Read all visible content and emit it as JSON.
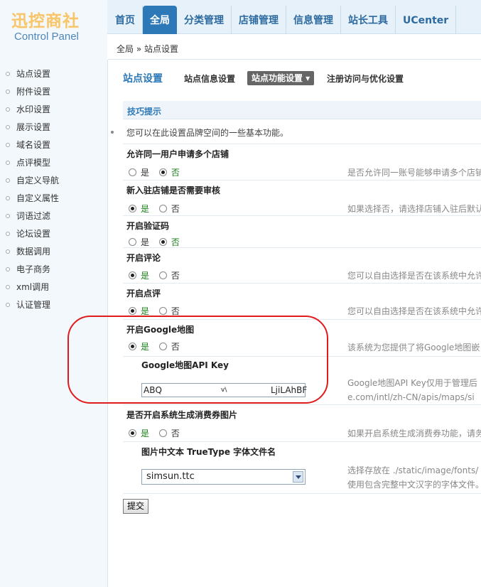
{
  "brand": {
    "name": "迅控商社",
    "subtitle": "Control Panel"
  },
  "nav": {
    "items": [
      {
        "label": "首页",
        "active": false
      },
      {
        "label": "全局",
        "active": true
      },
      {
        "label": "分类管理",
        "active": false
      },
      {
        "label": "店铺管理",
        "active": false
      },
      {
        "label": "信息管理",
        "active": false
      },
      {
        "label": "站长工具",
        "active": false
      },
      {
        "label": "UCenter",
        "active": false
      }
    ]
  },
  "breadcrumb": "全局 » 站点设置",
  "sidebar": {
    "items": [
      "站点设置",
      "附件设置",
      "水印设置",
      "展示设置",
      "域名设置",
      "点评模型",
      "自定义导航",
      "自定义属性",
      "词语过滤",
      "论坛设置",
      "数据调用",
      "电子商务",
      "xml调用",
      "认证管理"
    ]
  },
  "tabs": {
    "title": "站点设置",
    "items": [
      "站点信息设置",
      "站点功能设置 ▾",
      "注册访问与优化设置"
    ]
  },
  "tips": {
    "heading": "技巧提示",
    "line": "您可以在此设置品牌空间的一些基本功能。"
  },
  "radio_yes": "是",
  "radio_no": "否",
  "settings": {
    "multi_shop": {
      "label": "允许同一用户申请多个店铺",
      "hint": "是否允许同一账号能够申请多个店铺"
    },
    "shop_review": {
      "label": "新入驻店铺是否需要审核",
      "hint": "如果选择否，请选择店铺入驻后默认"
    },
    "captcha": {
      "label": "开启验证码"
    },
    "comment": {
      "label": "开启评论",
      "hint": "您可以自由选择是否在该系统中允许"
    },
    "review": {
      "label": "开启点评",
      "hint": "您可以自由选择是否在该系统中允许"
    },
    "google_map": {
      "label": "开启Google地图",
      "hint": "该系统为您提供了将Google地图嵌"
    },
    "api_key": {
      "label": "Google地图API Key",
      "value_start": "ABQ",
      "value_mid": "v\\",
      "value_end": "LjiLAhBF",
      "hint1": "Google地图API Key仅用于管理后",
      "hint2": "e.com/intl/zh-CN/apis/maps/si"
    },
    "coupon_img": {
      "label": "是否开启系统生成消费券图片",
      "hint": "如果开启系统生成消费券功能，请务"
    },
    "font_file": {
      "label": "图片中文本 TrueType 字体文件名",
      "value": "simsun.ttc",
      "hint1": "选择存放在 ./static/image/fonts/",
      "hint2": "使用包含完整中文汉字的字体文件。"
    }
  },
  "submit_label": "提交",
  "colors": {
    "accent": "#2d79b7",
    "annotation": "#e01b1b"
  }
}
